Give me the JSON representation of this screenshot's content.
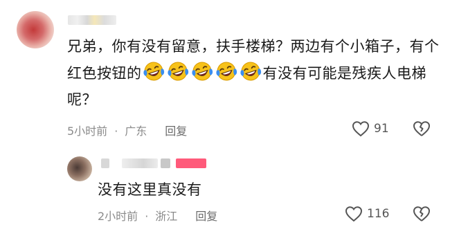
{
  "comments": [
    {
      "text_before": "兄弟，你有没有留意，扶手楼梯？两边有个小箱子，有个红色按钮的",
      "emoji_name": "laughing-crying-emoji",
      "emoji_count": 5,
      "text_after": "有没有可能是残疾人电梯呢？",
      "time": "5小时前",
      "separator": "·",
      "location": "广东",
      "reply_label": "回复",
      "likes": "91"
    },
    {
      "text": "没有这里真没有",
      "time": "2小时前",
      "separator": "·",
      "location": "浙江",
      "reply_label": "回复",
      "likes": "116"
    }
  ],
  "icons": {
    "like": "heart-outline-icon",
    "dislike": "broken-heart-icon"
  },
  "colors": {
    "meta_text": "#8a8a8a",
    "emoji_face": "#f7c21a",
    "emoji_tears": "#3a8ef0"
  }
}
